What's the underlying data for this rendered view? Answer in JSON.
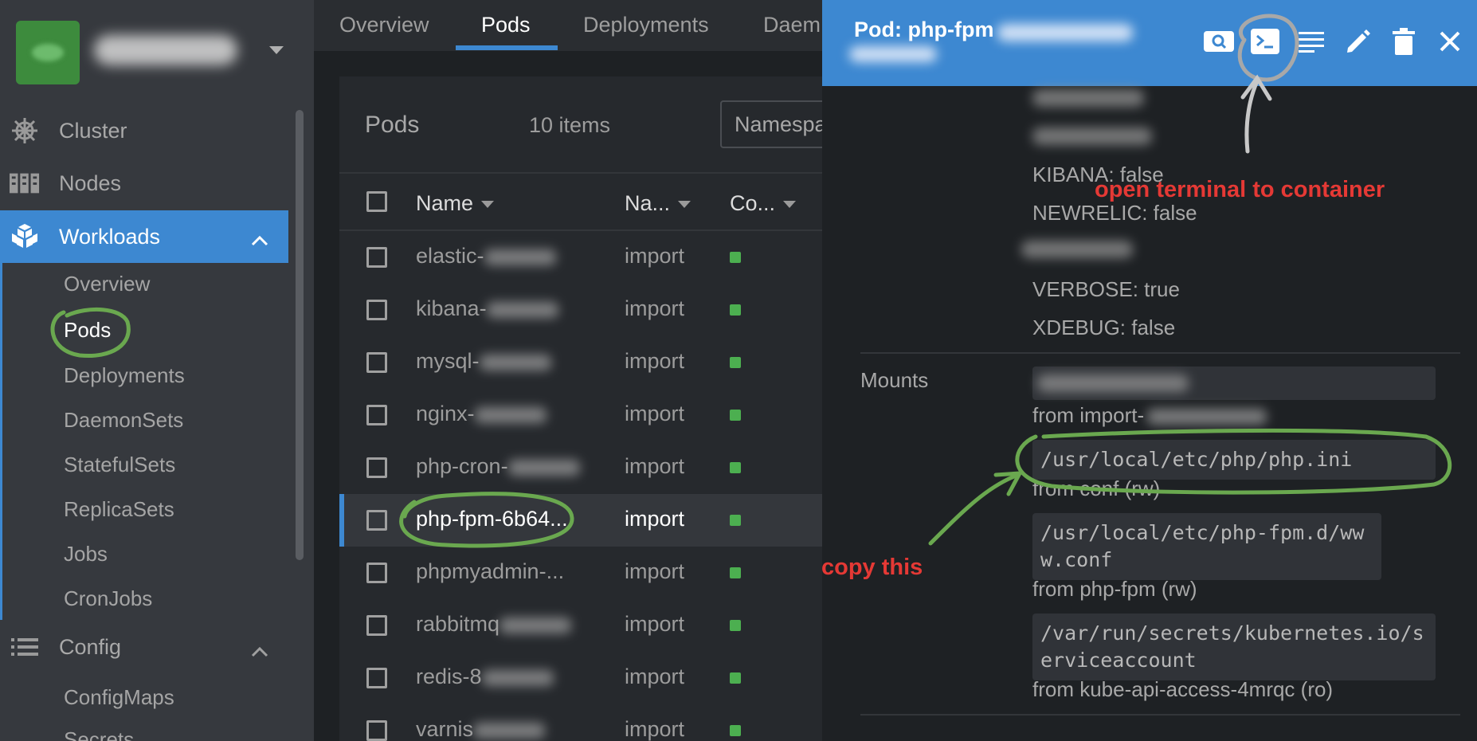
{
  "sidebar": {
    "nav": [
      {
        "label": "Cluster",
        "icon": "helm-wheel-icon"
      },
      {
        "label": "Nodes",
        "icon": "nodes-icon"
      },
      {
        "label": "Workloads",
        "icon": "workloads-cubes-icon"
      },
      {
        "label": "Config",
        "icon": "list-icon"
      }
    ],
    "workloads_sub": [
      "Overview",
      "Pods",
      "Deployments",
      "DaemonSets",
      "StatefulSets",
      "ReplicaSets",
      "Jobs",
      "CronJobs"
    ],
    "config_sub": [
      "ConfigMaps",
      "Secrets"
    ]
  },
  "tabs": [
    "Overview",
    "Pods",
    "Deployments",
    "Daem"
  ],
  "pods_panel": {
    "title": "Pods",
    "count": "10 items",
    "namespace_placeholder": "Namespa",
    "columns": [
      "Name",
      "Na...",
      "Co..."
    ],
    "rows": [
      {
        "name": "elastic-",
        "namespace": "import"
      },
      {
        "name": "kibana-",
        "namespace": "import"
      },
      {
        "name": "mysql-",
        "namespace": "import"
      },
      {
        "name": "nginx-",
        "namespace": "import"
      },
      {
        "name": "php-cron-",
        "namespace": "import"
      },
      {
        "name": "php-fpm-6b64...",
        "namespace": "import"
      },
      {
        "name": "phpmyadmin-...",
        "namespace": "import"
      },
      {
        "name": "rabbitmq",
        "namespace": "import"
      },
      {
        "name": "redis-8",
        "namespace": "import"
      },
      {
        "name": "varnis",
        "namespace": "import"
      }
    ]
  },
  "drawer": {
    "title": "Pod: php-fpm",
    "env": [
      "KIBANA: false",
      "NEWRELIC: false",
      "VERBOSE: true",
      "XDEBUG: false"
    ],
    "mounts_label": "Mounts",
    "mounts": [
      {
        "path": "",
        "from": "from import-"
      },
      {
        "path": "/usr/local/etc/php/php.ini",
        "from": "from conf (rw)"
      },
      {
        "path": "/usr/local/etc/php-fpm.d/www.conf",
        "from": "from php-fpm (rw)"
      },
      {
        "path": "/var/run/secrets/kubernetes.io/serviceaccount",
        "from": "from kube-api-access-4mrqc (ro)"
      }
    ]
  },
  "annotations": {
    "terminal": "open terminal to container",
    "copy": "copy this"
  },
  "colors": {
    "accent": "#3d88d1",
    "status_ok": "#4caf50",
    "annotation_red": "#e53935",
    "annotation_green": "#6aa84f"
  }
}
